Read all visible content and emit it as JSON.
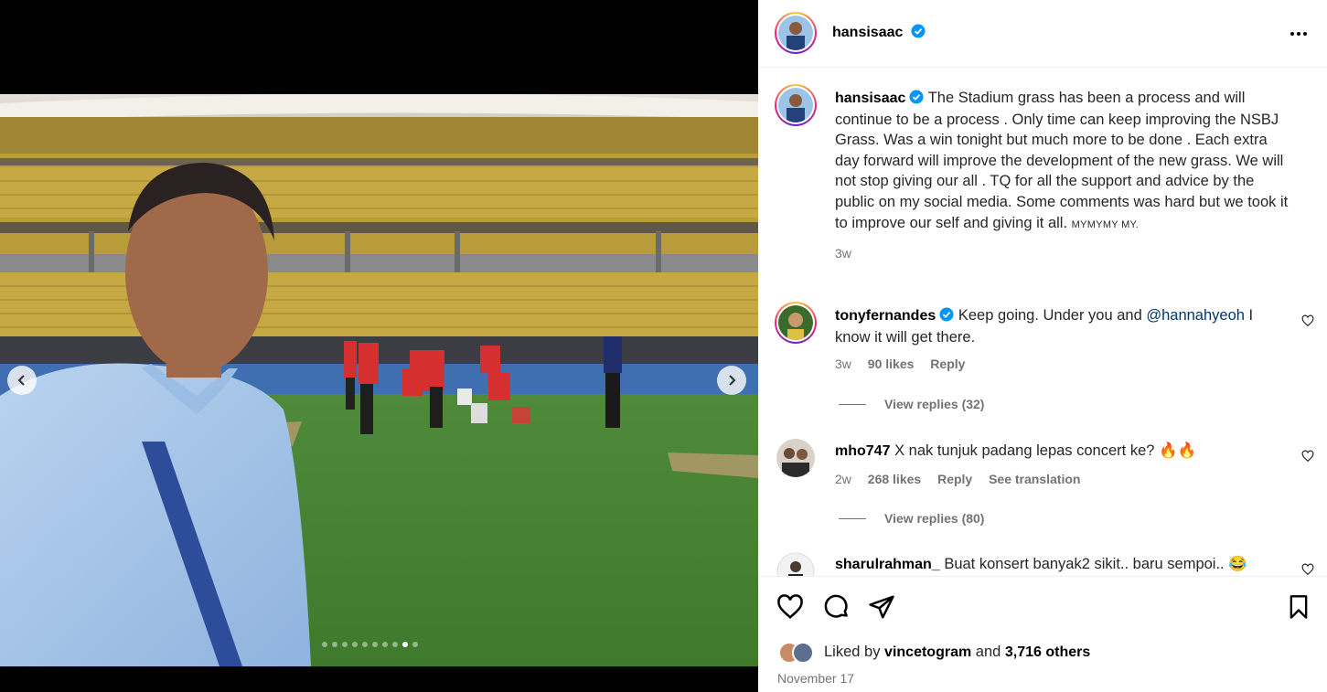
{
  "post": {
    "author": "hansisaac",
    "carousel": {
      "total_slides": 10,
      "active_slide_index": 8
    }
  },
  "caption": {
    "username": "hansisaac",
    "text": "The Stadium grass has been a process and will continue to be a process . Only time can keep improving the NSBJ Grass. Was a win tonight but much more to be done . Each extra day forward will improve the development of the new grass. We will not stop giving our all . TQ for all the support and advice by the public on my social media. Some comments was hard but we took it to improve our self and giving it all.",
    "tail": "MYMYMY MY.",
    "time": "3w"
  },
  "comments": [
    {
      "username": "tonyfernandes",
      "verified": true,
      "text_before": "Keep going. Under you and ",
      "mention": "@hannahyeoh",
      "text_after": " I know it will get there.",
      "time": "3w",
      "likes": "90 likes",
      "reply": "Reply",
      "view_replies": "View replies (32)"
    },
    {
      "username": "mho747",
      "verified": false,
      "text": "X nak tunjuk padang lepas concert ke? 🔥🔥",
      "time": "2w",
      "likes": "268 likes",
      "reply": "Reply",
      "translate": "See translation",
      "view_replies": "View replies (80)"
    },
    {
      "username": "sharulrahman_",
      "verified": false,
      "text": "Buat konsert banyak2 sikit.. baru sempoi.. 😂"
    }
  ],
  "footer": {
    "liked_prefix": "Liked by ",
    "liked_user": "vincetogram",
    "liked_mid": " and ",
    "liked_count": "3,716 others",
    "date": "November 17"
  },
  "icons": {
    "heart": "heart-icon",
    "comment": "comment-icon",
    "share": "share-icon",
    "save": "bookmark-icon",
    "more": "more-icon",
    "verified": "verified-badge-icon"
  },
  "colors": {
    "verified": "#0095f6",
    "mention": "#00376b",
    "muted": "#737373"
  }
}
